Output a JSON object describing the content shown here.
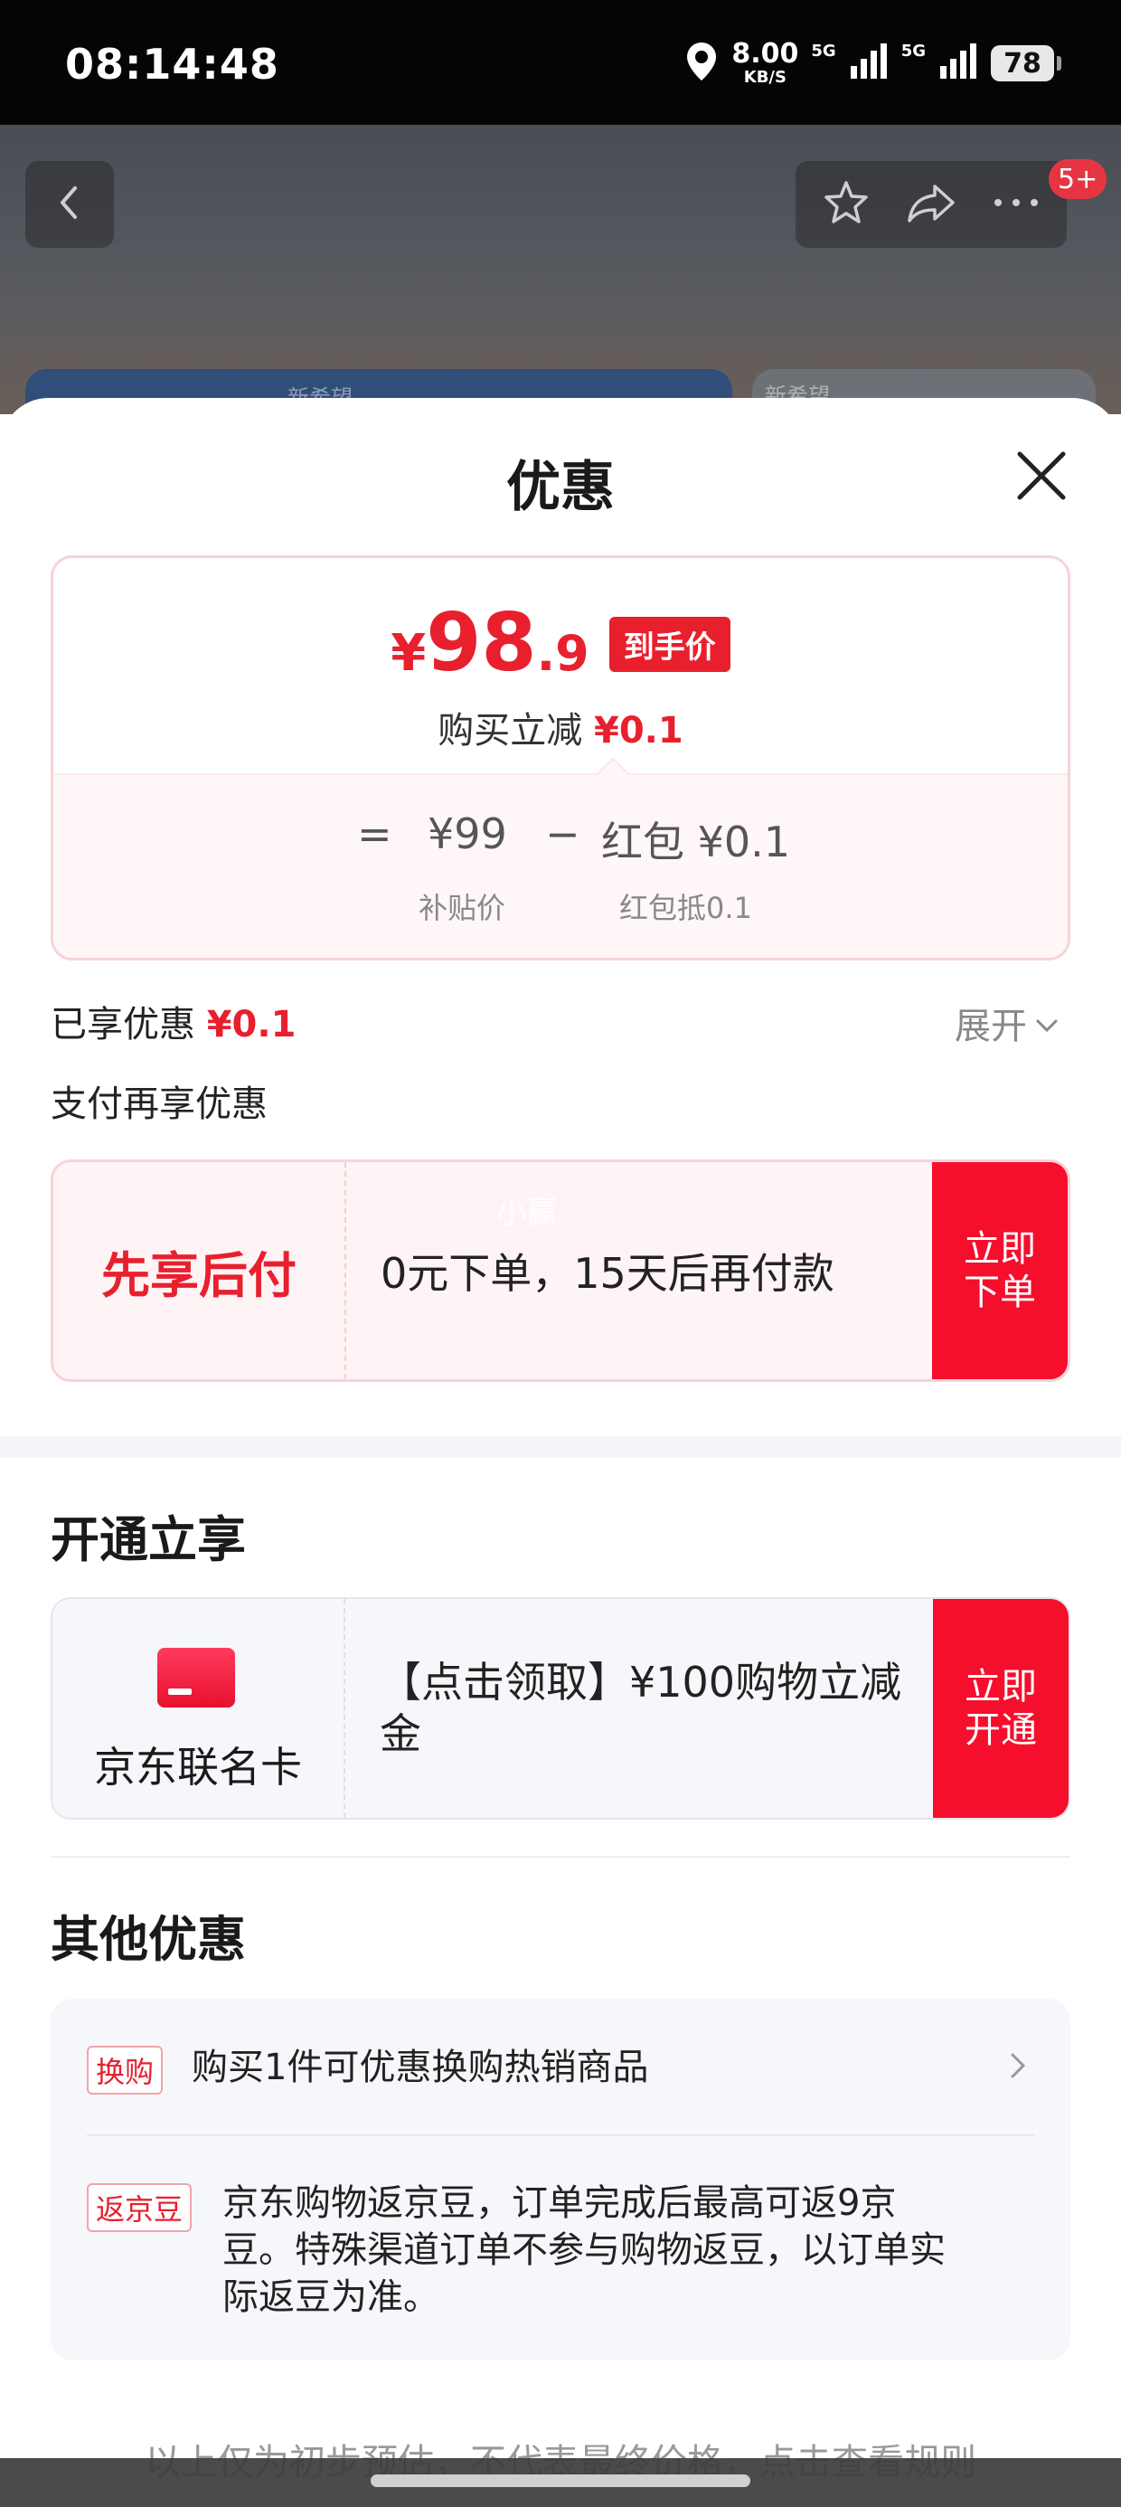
{
  "status_bar": {
    "time": "08:14:48",
    "speed_value": "8.00",
    "speed_unit": "KB/S",
    "net1": "5G",
    "net2": "5G",
    "battery": "78"
  },
  "background_page": {
    "badge": "5+",
    "banner1_text": "新希望",
    "banner2_text": "新希望"
  },
  "sheet": {
    "title": "优惠"
  },
  "price_card": {
    "currency": "¥",
    "price_int": "98",
    "price_dec": ".9",
    "tag": "到手价",
    "sub_label": "购买立减",
    "sub_amount": "¥0.1",
    "equals": "=",
    "base_price": "¥99",
    "minus": "−",
    "discount": "红包 ¥0.1",
    "base_label": "补贴价",
    "discount_label": "红包抵0.1"
  },
  "enjoyed": {
    "label": "已享优惠",
    "amount": "¥0.1",
    "expand": "展开"
  },
  "pay_section": {
    "title": "支付再享优惠",
    "left_label": "先享后付",
    "desc": "0元下单，15天后再付款",
    "button": "立即下单",
    "watermark": "小赢"
  },
  "open_section": {
    "title": "开通立享",
    "card_name": "京东联名卡",
    "desc": "【点击领取】¥100购物立减金",
    "button": "立即开通"
  },
  "other_section": {
    "title": "其他优惠",
    "items": [
      {
        "tag": "换购",
        "text": "购买1件可优惠换购热销商品"
      },
      {
        "tag": "返京豆",
        "text": "京东购物返京豆，订单完成后最高可返9京豆。特殊渠道订单不参与购物返豆，以订单实际返豆为准。"
      }
    ]
  },
  "footer": {
    "note": "以上仅为初步预估，不代表最终价格，点击查看规则"
  },
  "colors": {
    "accent_red": "#e8202e",
    "button_red": "#f50f2c"
  }
}
